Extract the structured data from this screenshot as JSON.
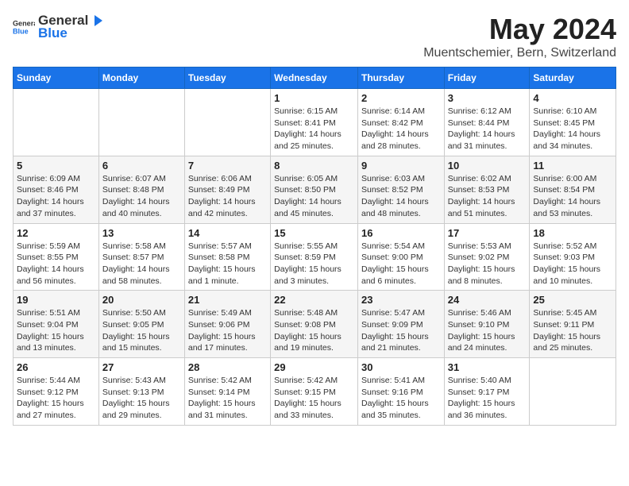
{
  "logo": {
    "general": "General",
    "blue": "Blue"
  },
  "header": {
    "title": "May 2024",
    "subtitle": "Muentschemier, Bern, Switzerland"
  },
  "days": [
    "Sunday",
    "Monday",
    "Tuesday",
    "Wednesday",
    "Thursday",
    "Friday",
    "Saturday"
  ],
  "weeks": [
    [
      {
        "date": "",
        "sunrise": "",
        "sunset": "",
        "daylight": ""
      },
      {
        "date": "",
        "sunrise": "",
        "sunset": "",
        "daylight": ""
      },
      {
        "date": "",
        "sunrise": "",
        "sunset": "",
        "daylight": ""
      },
      {
        "date": "1",
        "sunrise": "Sunrise: 6:15 AM",
        "sunset": "Sunset: 8:41 PM",
        "daylight": "Daylight: 14 hours and 25 minutes."
      },
      {
        "date": "2",
        "sunrise": "Sunrise: 6:14 AM",
        "sunset": "Sunset: 8:42 PM",
        "daylight": "Daylight: 14 hours and 28 minutes."
      },
      {
        "date": "3",
        "sunrise": "Sunrise: 6:12 AM",
        "sunset": "Sunset: 8:44 PM",
        "daylight": "Daylight: 14 hours and 31 minutes."
      },
      {
        "date": "4",
        "sunrise": "Sunrise: 6:10 AM",
        "sunset": "Sunset: 8:45 PM",
        "daylight": "Daylight: 14 hours and 34 minutes."
      }
    ],
    [
      {
        "date": "5",
        "sunrise": "Sunrise: 6:09 AM",
        "sunset": "Sunset: 8:46 PM",
        "daylight": "Daylight: 14 hours and 37 minutes."
      },
      {
        "date": "6",
        "sunrise": "Sunrise: 6:07 AM",
        "sunset": "Sunset: 8:48 PM",
        "daylight": "Daylight: 14 hours and 40 minutes."
      },
      {
        "date": "7",
        "sunrise": "Sunrise: 6:06 AM",
        "sunset": "Sunset: 8:49 PM",
        "daylight": "Daylight: 14 hours and 42 minutes."
      },
      {
        "date": "8",
        "sunrise": "Sunrise: 6:05 AM",
        "sunset": "Sunset: 8:50 PM",
        "daylight": "Daylight: 14 hours and 45 minutes."
      },
      {
        "date": "9",
        "sunrise": "Sunrise: 6:03 AM",
        "sunset": "Sunset: 8:52 PM",
        "daylight": "Daylight: 14 hours and 48 minutes."
      },
      {
        "date": "10",
        "sunrise": "Sunrise: 6:02 AM",
        "sunset": "Sunset: 8:53 PM",
        "daylight": "Daylight: 14 hours and 51 minutes."
      },
      {
        "date": "11",
        "sunrise": "Sunrise: 6:00 AM",
        "sunset": "Sunset: 8:54 PM",
        "daylight": "Daylight: 14 hours and 53 minutes."
      }
    ],
    [
      {
        "date": "12",
        "sunrise": "Sunrise: 5:59 AM",
        "sunset": "Sunset: 8:55 PM",
        "daylight": "Daylight: 14 hours and 56 minutes."
      },
      {
        "date": "13",
        "sunrise": "Sunrise: 5:58 AM",
        "sunset": "Sunset: 8:57 PM",
        "daylight": "Daylight: 14 hours and 58 minutes."
      },
      {
        "date": "14",
        "sunrise": "Sunrise: 5:57 AM",
        "sunset": "Sunset: 8:58 PM",
        "daylight": "Daylight: 15 hours and 1 minute."
      },
      {
        "date": "15",
        "sunrise": "Sunrise: 5:55 AM",
        "sunset": "Sunset: 8:59 PM",
        "daylight": "Daylight: 15 hours and 3 minutes."
      },
      {
        "date": "16",
        "sunrise": "Sunrise: 5:54 AM",
        "sunset": "Sunset: 9:00 PM",
        "daylight": "Daylight: 15 hours and 6 minutes."
      },
      {
        "date": "17",
        "sunrise": "Sunrise: 5:53 AM",
        "sunset": "Sunset: 9:02 PM",
        "daylight": "Daylight: 15 hours and 8 minutes."
      },
      {
        "date": "18",
        "sunrise": "Sunrise: 5:52 AM",
        "sunset": "Sunset: 9:03 PM",
        "daylight": "Daylight: 15 hours and 10 minutes."
      }
    ],
    [
      {
        "date": "19",
        "sunrise": "Sunrise: 5:51 AM",
        "sunset": "Sunset: 9:04 PM",
        "daylight": "Daylight: 15 hours and 13 minutes."
      },
      {
        "date": "20",
        "sunrise": "Sunrise: 5:50 AM",
        "sunset": "Sunset: 9:05 PM",
        "daylight": "Daylight: 15 hours and 15 minutes."
      },
      {
        "date": "21",
        "sunrise": "Sunrise: 5:49 AM",
        "sunset": "Sunset: 9:06 PM",
        "daylight": "Daylight: 15 hours and 17 minutes."
      },
      {
        "date": "22",
        "sunrise": "Sunrise: 5:48 AM",
        "sunset": "Sunset: 9:08 PM",
        "daylight": "Daylight: 15 hours and 19 minutes."
      },
      {
        "date": "23",
        "sunrise": "Sunrise: 5:47 AM",
        "sunset": "Sunset: 9:09 PM",
        "daylight": "Daylight: 15 hours and 21 minutes."
      },
      {
        "date": "24",
        "sunrise": "Sunrise: 5:46 AM",
        "sunset": "Sunset: 9:10 PM",
        "daylight": "Daylight: 15 hours and 24 minutes."
      },
      {
        "date": "25",
        "sunrise": "Sunrise: 5:45 AM",
        "sunset": "Sunset: 9:11 PM",
        "daylight": "Daylight: 15 hours and 25 minutes."
      }
    ],
    [
      {
        "date": "26",
        "sunrise": "Sunrise: 5:44 AM",
        "sunset": "Sunset: 9:12 PM",
        "daylight": "Daylight: 15 hours and 27 minutes."
      },
      {
        "date": "27",
        "sunrise": "Sunrise: 5:43 AM",
        "sunset": "Sunset: 9:13 PM",
        "daylight": "Daylight: 15 hours and 29 minutes."
      },
      {
        "date": "28",
        "sunrise": "Sunrise: 5:42 AM",
        "sunset": "Sunset: 9:14 PM",
        "daylight": "Daylight: 15 hours and 31 minutes."
      },
      {
        "date": "29",
        "sunrise": "Sunrise: 5:42 AM",
        "sunset": "Sunset: 9:15 PM",
        "daylight": "Daylight: 15 hours and 33 minutes."
      },
      {
        "date": "30",
        "sunrise": "Sunrise: 5:41 AM",
        "sunset": "Sunset: 9:16 PM",
        "daylight": "Daylight: 15 hours and 35 minutes."
      },
      {
        "date": "31",
        "sunrise": "Sunrise: 5:40 AM",
        "sunset": "Sunset: 9:17 PM",
        "daylight": "Daylight: 15 hours and 36 minutes."
      },
      {
        "date": "",
        "sunrise": "",
        "sunset": "",
        "daylight": ""
      }
    ]
  ]
}
